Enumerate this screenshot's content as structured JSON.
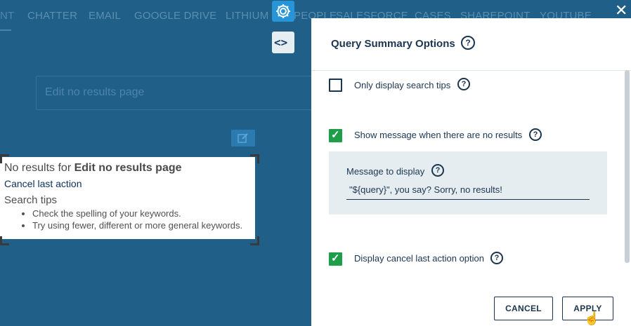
{
  "tabs": [
    "NT",
    "CHATTER",
    "EMAIL",
    "GOOGLE DRIVE",
    "LITHIUM",
    "PEOPLE",
    "SALESFORCE",
    "CASES",
    "SHAREPOINT",
    "YOUTUBE"
  ],
  "search": {
    "placeholder": "Edit no results page"
  },
  "preview": {
    "no_results_prefix": "No results for ",
    "no_results_query": "Edit no results page",
    "cancel_link": "Cancel last action",
    "tips_title": "Search tips",
    "tips": [
      "Check the spelling of your keywords.",
      "Try using fewer, different or more general keywords."
    ]
  },
  "toolbar": {
    "code_label": "<>"
  },
  "dialog": {
    "title": "Query Summary Options",
    "options": [
      {
        "label": "Only display search tips",
        "checked": false
      },
      {
        "label": "Show message when there are no results",
        "checked": true
      },
      {
        "label": "Display cancel last action option",
        "checked": true
      }
    ],
    "message_label": "Message to display",
    "message_value": "\"${query}\", you say? Sorry, no results!",
    "cancel_label": "CANCEL",
    "apply_label": "APPLY"
  },
  "icons": {
    "help": "?",
    "close": "✕"
  },
  "colors": {
    "accent": "#2796d8",
    "check": "#1e9e49",
    "text": "#1b3551",
    "overlay": "#1f5f88"
  }
}
